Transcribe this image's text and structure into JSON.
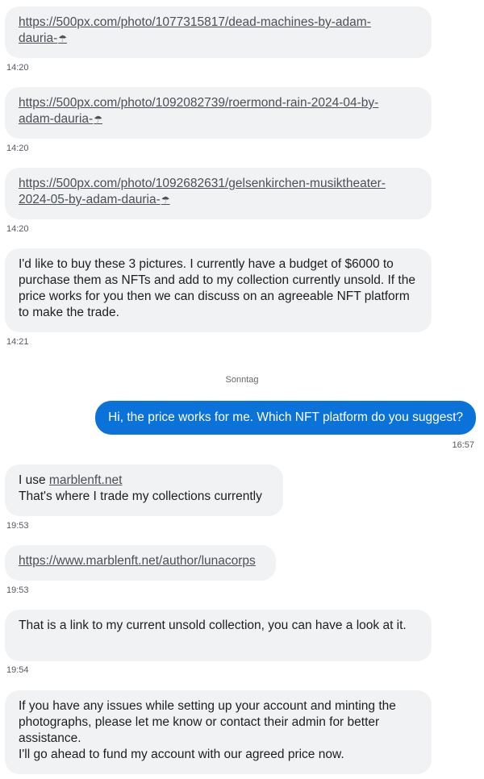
{
  "messages": [
    {
      "link": "https://500px.com/photo/1077315817/dead-machines-by-adam-dauria-",
      "link_line1": "https://500px.com/photo/1077315817/dead-machines-by-adam-",
      "link_line2": "dauria-",
      "time": "14:20"
    },
    {
      "link_line1": "https://500px.com/photo/1092082739/roermond-rain-2024-04-by-",
      "link_line2": "adam-dauria-",
      "time": "14:20"
    },
    {
      "link_line1": "https://500px.com/photo/1092682631/gelsenkirchen-musiktheater-",
      "link_line2": "2024-05-by-adam-dauria-",
      "time": "14:20"
    },
    {
      "text": "I'd like to buy these 3 pictures. I currently have a budget of $6000 to purchase them as NFTs and add to my collection currently unsold. If the price works for you then we can discuss on an agreeable NFT platform to make the trade.",
      "time": "14:21"
    }
  ],
  "day_separator": "Sonntag",
  "outgoing": {
    "text": "Hi, the price works for me. Which NFT platform do you suggest?",
    "time": "16:57"
  },
  "replies": [
    {
      "prefix": "I use ",
      "link": "marblenft.net",
      "line2": "That's where I trade my collections currently",
      "time": "19:53"
    },
    {
      "link": "https://www.marblenft.net/author/lunacorps",
      "time": "19:53"
    },
    {
      "text": "That is a link to my current unsold collection, you can have a look at it.",
      "time": "19:54"
    },
    {
      "text": "If you have any issues while setting up your account and minting the photographs, please let me know or contact their admin for better assistance.",
      "text2": "I'll go ahead to fund my account with our agreed price now."
    }
  ],
  "icons": {
    "link_suffix": "umbrella-icon",
    "umbrella_glyph": "☂"
  }
}
